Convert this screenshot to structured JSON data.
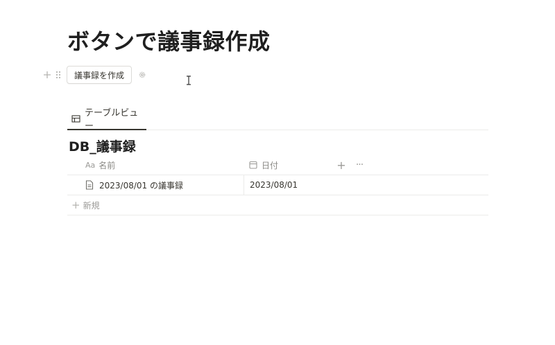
{
  "page": {
    "title": "ボタンで議事録作成"
  },
  "button_block": {
    "label": "議事録を作成",
    "icons": [
      "plus-icon",
      "drag-handle-icon",
      "gear-icon"
    ]
  },
  "database": {
    "view_tab_label": "テーブルビュー",
    "title": "DB_議事録",
    "columns": [
      {
        "type_icon": "Aa",
        "label": "名前"
      },
      {
        "type_icon": "calendar-icon",
        "label": "日付"
      }
    ],
    "rows": [
      {
        "name": "2023/08/01 の議事録",
        "date": "2023/08/01"
      }
    ],
    "new_label": "新規",
    "add_column_icon": "plus-icon",
    "more_icon": "ellipsis-icon"
  }
}
